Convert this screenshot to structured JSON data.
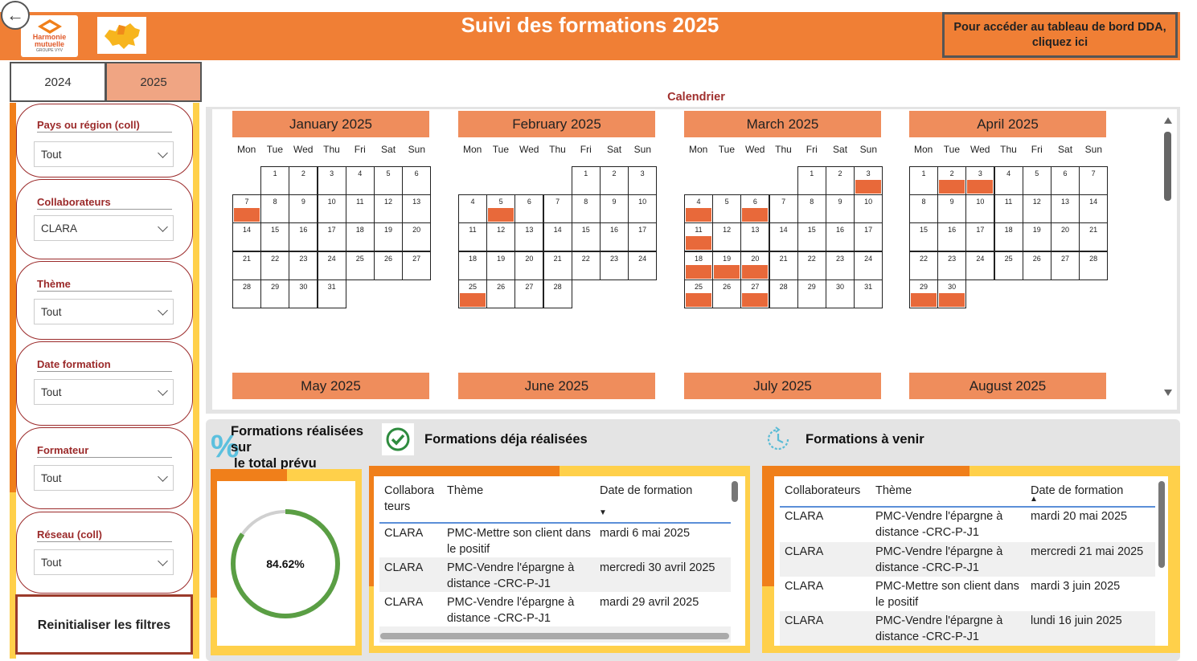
{
  "header": {
    "title": "Suivi des formations 2025",
    "dda_button": "Pour accéder au tableau de bord DDA, cliquez ici",
    "logo_text_1": "Harmonie",
    "logo_text_2": "mutuelle",
    "logo_text_3": "GROUPE VYV"
  },
  "year_tabs": [
    {
      "label": "2024",
      "selected": false
    },
    {
      "label": "2025",
      "selected": true
    }
  ],
  "filters": [
    {
      "label": "Pays ou région (coll)",
      "value": "Tout"
    },
    {
      "label": "Collaborateurs",
      "value": "CLARA"
    },
    {
      "label": "Thème",
      "value": "Tout"
    },
    {
      "label": "Date formation",
      "value": "Tout"
    },
    {
      "label": "Formateur",
      "value": "Tout"
    },
    {
      "label": "Réseau (coll)",
      "value": "Tout"
    }
  ],
  "reset_button": "Reinitialiser les filtres",
  "calendar": {
    "title": "Calendrier",
    "weekdays": [
      "Mon",
      "Tue",
      "Wed",
      "Thu",
      "Fri",
      "Sat",
      "Sun"
    ],
    "months": [
      {
        "name": "January 2025",
        "start": 2,
        "days": 31,
        "marked": [
          7
        ]
      },
      {
        "name": "February 2025",
        "start": 5,
        "days": 28,
        "marked": [
          5,
          25
        ]
      },
      {
        "name": "March 2025",
        "start": 5,
        "days": 31,
        "marked": [
          3,
          4,
          6,
          11,
          18,
          19,
          20,
          25,
          27
        ]
      },
      {
        "name": "April 2025",
        "start": 1,
        "days": 30,
        "marked": [
          2,
          3,
          29,
          30
        ]
      }
    ],
    "next_months": [
      "May 2025",
      "June 2025",
      "July 2025",
      "August 2025"
    ],
    "mark_color": "#e8693a"
  },
  "kpi": {
    "heading_line1": "Formations réalisées",
    "heading_line2": "sur",
    "heading_line3": "le total prévu",
    "icon_glyph": "%",
    "value": "84.62%",
    "fraction": 0.8462,
    "ring_color": "#5a9e44"
  },
  "done_table": {
    "heading": "Formations déja réalisées",
    "headers": [
      "Collabora teurs",
      "Thème",
      "Date de formation"
    ],
    "sort_indicator": "▼",
    "rows": [
      [
        "CLARA",
        "PMC-Mettre son client dans le positif",
        "mardi 6 mai 2025"
      ],
      [
        "CLARA",
        "PMC-Vendre l'épargne à distance -CRC-P-J1",
        "mercredi 30 avril 2025"
      ],
      [
        "CLARA",
        "PMC-Vendre l'épargne à distance -CRC-P-J1",
        "mardi 29 avril 2025"
      ]
    ]
  },
  "upcoming_table": {
    "heading": "Formations à venir",
    "headers": [
      "Collaborateurs",
      "Thème",
      "Date de formation"
    ],
    "sort_indicator": "▲",
    "rows": [
      [
        "CLARA",
        "PMC-Vendre l'épargne à distance -CRC-P-J1",
        "mardi 20 mai 2025"
      ],
      [
        "CLARA",
        "PMC-Vendre l'épargne à distance -CRC-P-J1",
        "mercredi 21 mai 2025"
      ],
      [
        "CLARA",
        "PMC-Mettre son client dans le positif",
        "mardi 3 juin 2025"
      ],
      [
        "CLARA",
        "PMC-Vendre l'épargne à distance -CRC-P-J1",
        "lundi 16 juin 2025"
      ]
    ]
  },
  "colors": {
    "header_orange": "#f07f35",
    "accent_yellow": "#ffd04a",
    "label_red": "#9b2a2a",
    "month_header": "#ef8d5c"
  }
}
